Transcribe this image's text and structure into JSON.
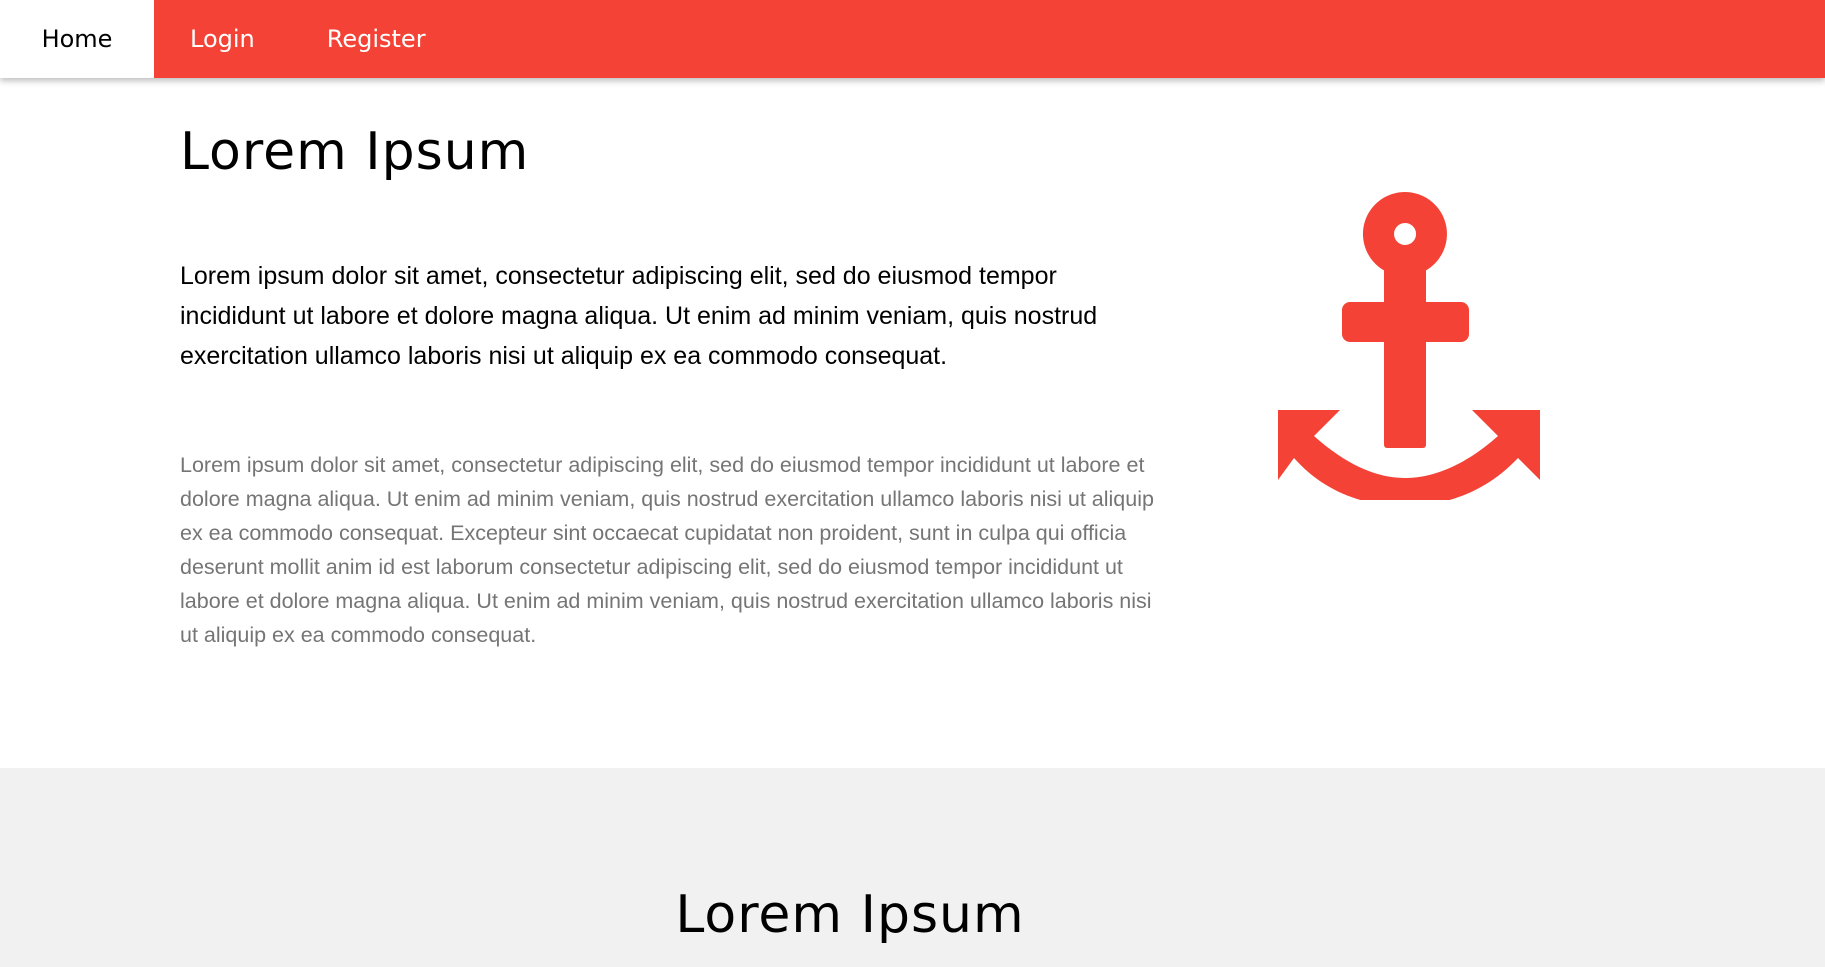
{
  "nav": {
    "items": [
      {
        "label": "Home",
        "active": true
      },
      {
        "label": "Login",
        "active": false
      },
      {
        "label": "Register",
        "active": false
      }
    ]
  },
  "hero": {
    "title": "Lorem Ipsum",
    "lead": "Lorem ipsum dolor sit amet, consectetur adipiscing elit, sed do eiusmod tempor incididunt ut labore et dolore magna aliqua. Ut enim ad minim veniam, quis nostrud exercitation ullamco laboris nisi ut aliquip ex ea commodo consequat.",
    "body": "Lorem ipsum dolor sit amet, consectetur adipiscing elit, sed do eiusmod tempor incididunt ut labore et dolore magna aliqua. Ut enim ad minim veniam, quis nostrud exercitation ullamco laboris nisi ut aliquip ex ea commodo consequat. Excepteur sint occaecat cupidatat non proident, sunt in culpa qui officia deserunt mollit anim id est laborum consectetur adipiscing elit, sed do eiusmod tempor incididunt ut labore et dolore magna aliqua. Ut enim ad minim veniam, quis nostrud exercitation ullamco laboris nisi ut aliquip ex ea commodo consequat.",
    "icon": "anchor-icon"
  },
  "section2": {
    "title": "Lorem Ipsum"
  },
  "colors": {
    "accent": "#f44336",
    "section_bg": "#f1f1f1",
    "muted_text": "#757575"
  }
}
